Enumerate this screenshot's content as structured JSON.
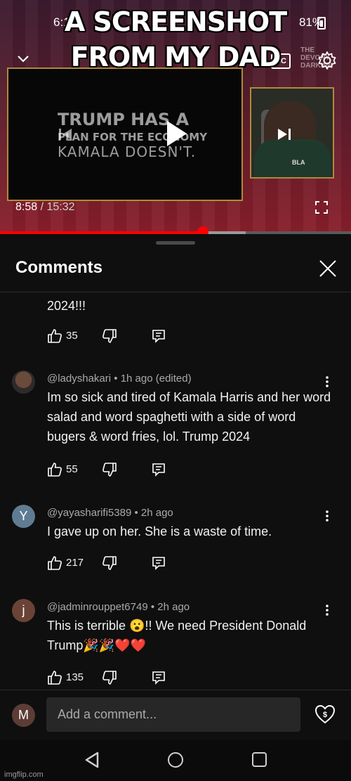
{
  "meme": {
    "caption_line1": "A SCREENSHOT",
    "caption_line2": "FROM MY DAD"
  },
  "status_bar": {
    "time": "6:1",
    "battery": "81%"
  },
  "player": {
    "brand": "THE DEVORY DARKINS",
    "cc_label": "CC",
    "slide_line1": "TRUMP HAS A",
    "slide_line2": "PLAN FOR THE ECONOMY",
    "slide_line3": "KAMALA DOESN'T.",
    "shirt_text": "BLA",
    "current_time": "8:58",
    "separator": " / ",
    "duration": "15:32",
    "progress_fraction": 0.577,
    "buffer_fraction": 0.7
  },
  "comments_panel": {
    "title": "Comments",
    "comments": [
      {
        "text": "2024!!!",
        "likes": "35"
      },
      {
        "author": "@ladyshakari",
        "age": "1h ago (edited)",
        "text": "Im so sick and tired of Kamala Harris and her word salad and word spaghetti with a side of word bugers & word fries, lol. Trump 2024",
        "likes": "55"
      },
      {
        "author": "@yayasharifi5389",
        "age": "2h ago",
        "avatar_letter": "Y",
        "text": "I gave up on her. She is a waste of time.",
        "likes": "217"
      },
      {
        "author": "@jadminrouppet6749",
        "age": "2h ago",
        "avatar_letter": "j",
        "text": "This is terrible 😮!! We need President Donald Trump🎉🎉❤️❤️",
        "likes": "135"
      }
    ]
  },
  "composer": {
    "avatar_letter": "M",
    "placeholder": "Add a comment..."
  },
  "watermark": "imgflip.com",
  "colors": {
    "accent": "#ff0000",
    "background": "#0f0f0f",
    "secondary_text": "#aaaaaa"
  }
}
